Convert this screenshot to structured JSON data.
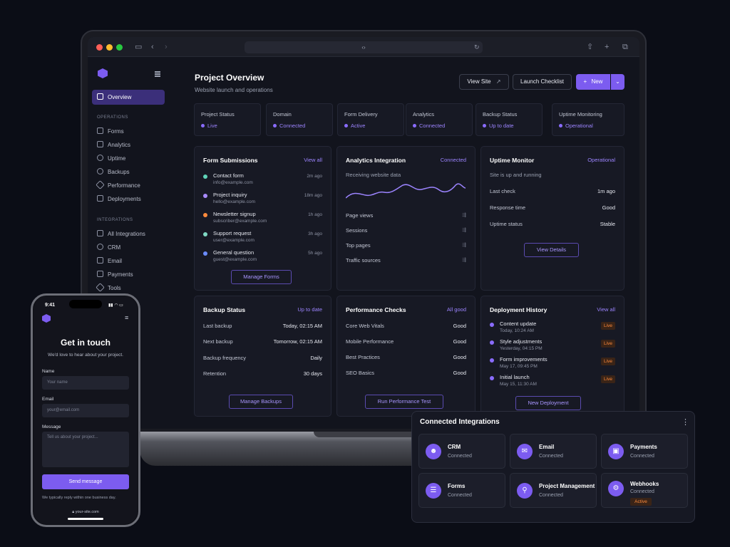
{
  "browser": {
    "address": "‹›"
  },
  "sidebar": {
    "overview": "Overview",
    "sections": {
      "operations": "OPERATIONS",
      "integrations": "INTEGRATIONS"
    },
    "operations_items": [
      "Forms",
      "Analytics",
      "Uptime",
      "Backups",
      "Performance",
      "Deployments"
    ],
    "integrations_items": [
      "All Integrations",
      "CRM",
      "Email",
      "Payments",
      "Tools"
    ]
  },
  "header": {
    "title": "Project Overview",
    "subtitle": "Website launch and operations",
    "view_site": "View Site",
    "launch_checklist": "Launch Checklist",
    "new": "New"
  },
  "stats": [
    {
      "title": "Project Status",
      "value": "Live"
    },
    {
      "title": "Domain",
      "value": "Connected"
    },
    {
      "title": "Form Delivery",
      "value": "Active"
    },
    {
      "title": "Analytics",
      "value": "Connected"
    },
    {
      "title": "Backup Status",
      "value": "Up to date"
    },
    {
      "title": "Uptime Monitoring",
      "value": "Operational"
    }
  ],
  "forms_panel": {
    "title": "Form Submissions",
    "link": "View all",
    "items": [
      {
        "name": "Contact form",
        "email": "info@example.com",
        "time": "2m ago",
        "color": "#5fd3b8"
      },
      {
        "name": "Project inquiry",
        "email": "hello@example.com",
        "time": "18m ago",
        "color": "#a98bff"
      },
      {
        "name": "Newsletter signup",
        "email": "subscriber@example.com",
        "time": "1h ago",
        "color": "#ff8a3c"
      },
      {
        "name": "Support request",
        "email": "user@example.com",
        "time": "3h ago",
        "color": "#7fd9c4"
      },
      {
        "name": "General question",
        "email": "guest@example.com",
        "time": "5h ago",
        "color": "#6b8cff"
      }
    ],
    "button": "Manage Forms"
  },
  "analytics_panel": {
    "title": "Analytics Integration",
    "status": "Connected",
    "subtitle": "Receiving website data",
    "rows": [
      "Page views",
      "Sessions",
      "Top pages",
      "Traffic sources"
    ]
  },
  "uptime_panel": {
    "title": "Uptime Monitor",
    "status": "Operational",
    "subtitle": "Site is up and running",
    "rows": [
      {
        "label": "Last check",
        "value": "1m ago"
      },
      {
        "label": "Response time",
        "value": "Good"
      },
      {
        "label": "Uptime status",
        "value": "Stable"
      }
    ],
    "button": "View Details"
  },
  "backup_panel": {
    "title": "Backup Status",
    "status": "Up to date",
    "rows": [
      {
        "label": "Last backup",
        "value": "Today, 02:15 AM"
      },
      {
        "label": "Next backup",
        "value": "Tomorrow, 02:15 AM"
      },
      {
        "label": "Backup frequency",
        "value": "Daily"
      },
      {
        "label": "Retention",
        "value": "30 days"
      }
    ],
    "button": "Manage Backups"
  },
  "performance_panel": {
    "title": "Performance Checks",
    "status": "All good",
    "rows": [
      {
        "label": "Core Web Vitals",
        "value": "Good"
      },
      {
        "label": "Mobile Performance",
        "value": "Good"
      },
      {
        "label": "Best Practices",
        "value": "Good"
      },
      {
        "label": "SEO Basics",
        "value": "Good"
      }
    ],
    "button": "Run Performance Test"
  },
  "deploy_panel": {
    "title": "Deployment History",
    "link": "View all",
    "items": [
      {
        "name": "Content update",
        "date": "Today, 10:24 AM",
        "badge": "Live"
      },
      {
        "name": "Style adjustments",
        "date": "Yesterday, 04:15 PM",
        "badge": "Live"
      },
      {
        "name": "Form improvements",
        "date": "May 17, 09:45 PM",
        "badge": "Live"
      },
      {
        "name": "Initial launch",
        "date": "May 15, 11:30 AM",
        "badge": "Live"
      }
    ],
    "button": "New Deployment"
  },
  "integrations_card": {
    "title": "Connected Integrations",
    "tiles": [
      {
        "name": "CRM",
        "status": "Connected",
        "icon": "people-icon"
      },
      {
        "name": "Email",
        "status": "Connected",
        "icon": "mail-icon"
      },
      {
        "name": "Payments",
        "status": "Connected",
        "icon": "card-icon"
      },
      {
        "name": "Forms",
        "status": "Connected",
        "icon": "form-icon"
      },
      {
        "name": "Project Management",
        "status": "Connected",
        "icon": "broadcast-icon"
      },
      {
        "name": "Webhooks",
        "status": "Connected",
        "icon": "webhook-icon",
        "badge": "Active"
      }
    ]
  },
  "phone": {
    "time": "9:41",
    "title": "Get in touch",
    "subtitle": "We'd love to hear about your project.",
    "name_label": "Name",
    "name_placeholder": "Your name",
    "email_label": "Email",
    "email_placeholder": "your@email.com",
    "message_label": "Message",
    "message_placeholder": "Tell us about your project...",
    "send": "Send message",
    "footnote": "We typically reply within one business day.",
    "url": "your-site.com"
  },
  "colors": {
    "accent": "#7c5cf0",
    "accent_text": "#9c84ff",
    "live_orange": "#ff8a3c"
  }
}
